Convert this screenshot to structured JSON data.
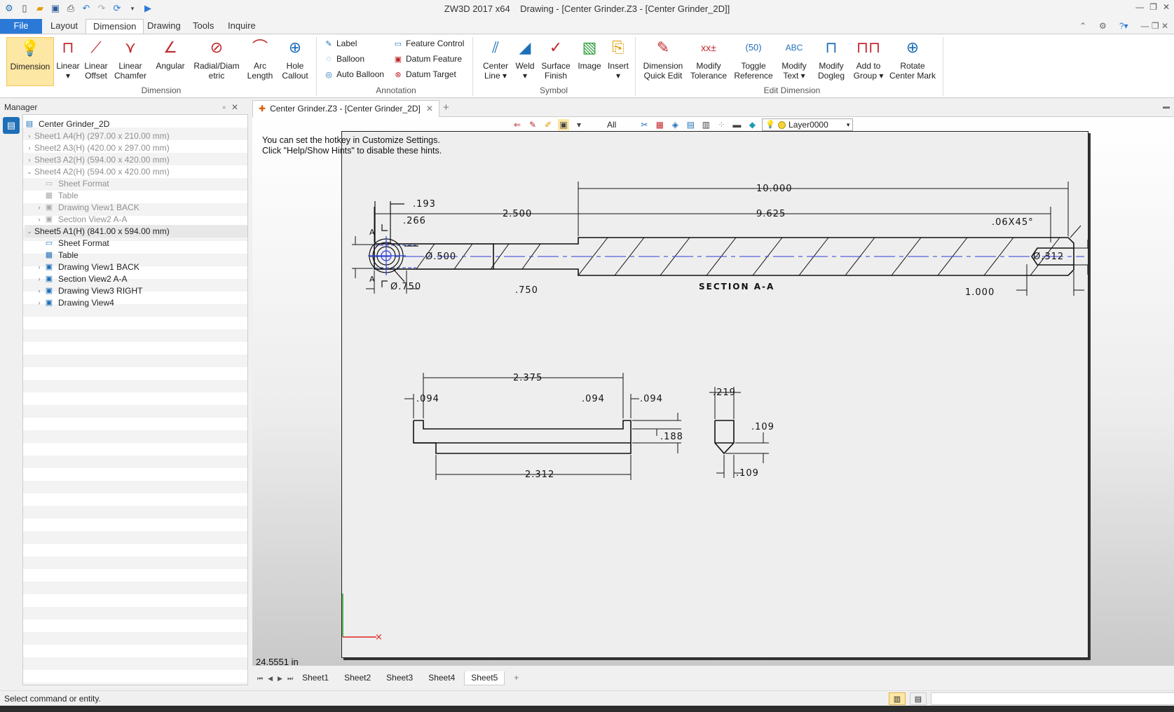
{
  "app": {
    "title": "ZW3D 2017  x64",
    "doc_title": "Drawing - [Center Grinder.Z3 - [Center Grinder_2D]]"
  },
  "menu": {
    "file": "File",
    "tabs": [
      "Layout",
      "Dimension",
      "Drawing",
      "Tools",
      "Inquire"
    ]
  },
  "ribbon": {
    "dimension_group": {
      "label": "Dimension",
      "buttons": [
        {
          "label": "Dimension",
          "label2": "",
          "icon": "dimension-bulb-icon"
        },
        {
          "label": "Linear",
          "label2": "▾",
          "icon": "linear-dimension-icon"
        },
        {
          "label": "Linear",
          "label2": "Offset",
          "icon": "linear-offset-icon"
        },
        {
          "label": "Linear",
          "label2": "Chamfer",
          "icon": "linear-chamfer-icon"
        },
        {
          "label": "Angular",
          "label2": "",
          "icon": "angular-dimension-icon"
        },
        {
          "label": "Radial/Diam",
          "label2": "etric",
          "icon": "radial-dimension-icon"
        },
        {
          "label": "Arc",
          "label2": "Length",
          "icon": "arc-length-icon"
        },
        {
          "label": "Hole",
          "label2": "Callout",
          "icon": "hole-callout-icon"
        }
      ]
    },
    "annotation_group": {
      "label": "Annotation",
      "col1": [
        "Label",
        "Balloon",
        "Auto Balloon"
      ],
      "col2": [
        "Feature Control",
        "Datum Feature",
        "Datum Target"
      ]
    },
    "symbol_group": {
      "label": "Symbol",
      "buttons": [
        {
          "label": "Center",
          "label2": "Line ▾"
        },
        {
          "label": "Weld",
          "label2": "▾"
        },
        {
          "label": "Surface",
          "label2": "Finish"
        },
        {
          "label": "Image",
          "label2": ""
        },
        {
          "label": "Insert",
          "label2": "▾"
        }
      ]
    },
    "edit_group": {
      "label": "Edit Dimension",
      "buttons": [
        {
          "label": "Dimension",
          "label2": "Quick Edit"
        },
        {
          "label": "Modify",
          "label2": "Tolerance"
        },
        {
          "label": "Toggle",
          "label2": "Reference"
        },
        {
          "label": "Modify",
          "label2": "Text ▾"
        },
        {
          "label": "Modify",
          "label2": "Dogleg"
        },
        {
          "label": "Add to",
          "label2": "Group ▾"
        },
        {
          "label": "Rotate",
          "label2": "Center Mark"
        }
      ]
    }
  },
  "manager": {
    "title": "Manager",
    "root": "Center Grinder_2D",
    "items": [
      {
        "label": "Sheet1 A4(H) (297.00 x 210.00 mm)",
        "dim": true,
        "arrow": "›",
        "indent": 0
      },
      {
        "label": "Sheet2 A3(H) (420.00 x 297.00 mm)",
        "dim": true,
        "arrow": "›",
        "indent": 0
      },
      {
        "label": "Sheet3 A2(H) (594.00 x 420.00 mm)",
        "dim": true,
        "arrow": "›",
        "indent": 0
      },
      {
        "label": "Sheet4 A2(H) (594.00 x 420.00 mm)",
        "dim": true,
        "arrow": "⌄",
        "indent": 0
      },
      {
        "label": "Sheet Format",
        "dim": true,
        "arrow": "",
        "indent": 1
      },
      {
        "label": "Table",
        "dim": true,
        "arrow": "",
        "indent": 1
      },
      {
        "label": "Drawing View1 BACK",
        "dim": true,
        "arrow": "›",
        "indent": 1
      },
      {
        "label": "Section View2 A-A",
        "dim": true,
        "arrow": "›",
        "indent": 1
      },
      {
        "label": "Sheet5 A1(H) (841.00 x 594.00 mm)",
        "dim": false,
        "arrow": "⌄",
        "indent": 0
      },
      {
        "label": "Sheet Format",
        "dim": false,
        "arrow": "",
        "indent": 1
      },
      {
        "label": "Table",
        "dim": false,
        "arrow": "",
        "indent": 1
      },
      {
        "label": "Drawing View1 BACK",
        "dim": false,
        "arrow": "›",
        "indent": 1
      },
      {
        "label": "Section View2 A-A",
        "dim": false,
        "arrow": "›",
        "indent": 1
      },
      {
        "label": "Drawing View3 RIGHT",
        "dim": false,
        "arrow": "›",
        "indent": 1
      },
      {
        "label": "Drawing View4",
        "dim": false,
        "arrow": "›",
        "indent": 1
      }
    ]
  },
  "doc_tab": {
    "label": "Center Grinder.Z3 - [Center Grinder_2D]"
  },
  "toolbar": {
    "filter": "All",
    "layer": "Layer0000"
  },
  "hints": {
    "line1": "You can set the hotkey in Customize Settings.",
    "line2": "Click \"Help/Show Hints\" to disable these hints."
  },
  "drawing": {
    "dims": {
      "d10": "10.000",
      "d2500": "2.500",
      "d9625": "9.625",
      "chamfer": ".06X45°",
      "d193": ".193",
      "d266": ".266",
      "dia500": "Ø.500",
      "dia750": "Ø.750",
      "d750": ".750",
      "d1000": "1.000",
      "dia312": "Ø.312",
      "section_title": "SECTION A-A",
      "markA1": "A",
      "markA2": "A",
      "d2375": "2.375",
      "d094a": ".094",
      "d094b": ".094",
      "d094c": ".094",
      "d188": ".188",
      "d2312": "2.312",
      "d219": ".219",
      "d109a": ".109",
      "d109b": ".109"
    }
  },
  "coord_readout": "24.5551 in",
  "sheet_tabs": [
    "Sheet1",
    "Sheet2",
    "Sheet3",
    "Sheet4",
    "Sheet5"
  ],
  "active_sheet": "Sheet5",
  "status": {
    "text": "Select command or entity."
  }
}
